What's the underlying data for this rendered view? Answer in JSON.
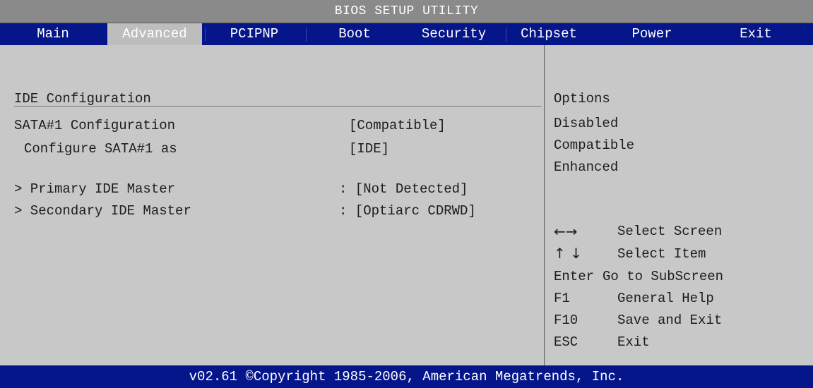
{
  "title": "BIOS SETUP UTILITY",
  "menu": [
    {
      "label": "Main"
    },
    {
      "label": "Advanced",
      "active": true
    },
    {
      "label": "PCIPNP"
    },
    {
      "label": "Boot"
    },
    {
      "label": "Security"
    },
    {
      "label": "Chipset"
    },
    {
      "label": "Power"
    },
    {
      "label": "Exit"
    }
  ],
  "main": {
    "heading": "IDE Configuration",
    "settings": [
      {
        "label": "SATA#1 Configuration",
        "value": "[Compatible]"
      },
      {
        "label": "Configure SATA#1 as",
        "value": "[IDE]"
      },
      {
        "label": "> Primary IDE Master",
        "value": ": [Not Detected]"
      },
      {
        "label": "> Secondary IDE Master",
        "value": ": [Optiarc CDRWD]"
      }
    ]
  },
  "help": {
    "title": "Options",
    "options": [
      "Disabled",
      "Compatible",
      "Enhanced"
    ],
    "keys": [
      {
        "key": "←→",
        "icon": "left-right-arrows-icon",
        "action": "Select Screen"
      },
      {
        "key": "↑ ↓",
        "icon": "up-down-arrows-icon",
        "action": "Select Item"
      },
      {
        "key": "Enter",
        "action": "Go to SubScreen"
      },
      {
        "key": "F1",
        "action": "General Help"
      },
      {
        "key": "F10",
        "action": "Save and Exit"
      },
      {
        "key": "ESC",
        "action": "Exit"
      }
    ]
  },
  "footer": "v02.61 ©Copyright 1985-2006, American Megatrends, Inc.",
  "colors": {
    "menu_bar": "#05168a",
    "active_tab": "#bdbdbd",
    "panel_bg": "#c8c8c8",
    "title_bar": "#8a8a8a"
  }
}
